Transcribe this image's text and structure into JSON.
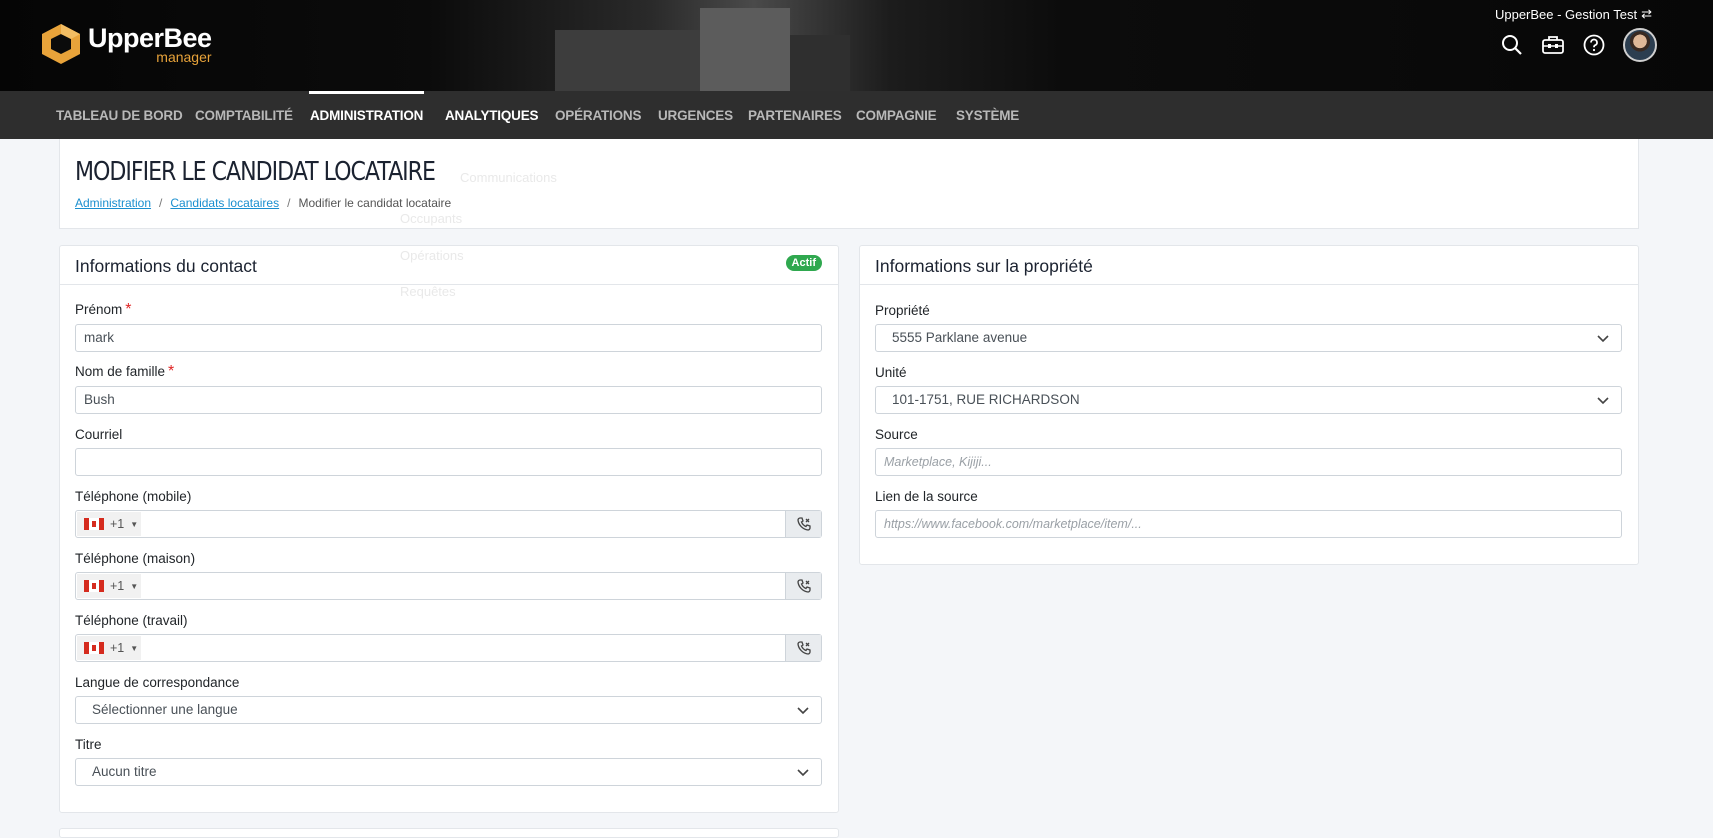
{
  "app": {
    "brand_main": "UpperBee",
    "brand_sub": "manager",
    "org_switch": "UpperBee - Gestion Test",
    "switch_glyph": "⇄"
  },
  "nav": [
    {
      "label": "TABLEAU DE BORD"
    },
    {
      "label": "COMPTABILITÉ"
    },
    {
      "label": "ADMINISTRATION"
    },
    {
      "label": "ANALYTIQUES"
    },
    {
      "label": "OPÉRATIONS"
    },
    {
      "label": "URGENCES"
    },
    {
      "label": "PARTENAIRES"
    },
    {
      "label": "COMPAGNIE"
    },
    {
      "label": "SYSTÈME"
    }
  ],
  "page": {
    "title": "MODIFIER LE CANDIDAT LOCATAIRE",
    "breadcrumb": [
      "Administration",
      "Candidats locataires",
      "Modifier le candidat locataire"
    ]
  },
  "ghost_menu": [
    "Communications",
    "Occupants",
    "Opérations",
    "Requêtes"
  ],
  "contact": {
    "title": "Informations du contact",
    "status": "Actif",
    "first_name_label": "Prénom",
    "first_name_value": "mark",
    "last_name_label": "Nom de famille",
    "last_name_value": "Bush",
    "email_label": "Courriel",
    "email_value": "",
    "phone_mobile_label": "Téléphone (mobile)",
    "phone_home_label": "Téléphone (maison)",
    "phone_work_label": "Téléphone (travail)",
    "dial_code": "+1",
    "language_label": "Langue de correspondance",
    "language_value": "Sélectionner une langue",
    "title_label": "Titre",
    "title_value": "Aucun titre",
    "required_mark": "*"
  },
  "property": {
    "title": "Informations sur la propriété",
    "property_label": "Propriété",
    "property_value": "5555 Parklane avenue",
    "unit_label": "Unité",
    "unit_value": "101-1751, RUE RICHARDSON",
    "source_label": "Source",
    "source_placeholder": "Marketplace, Kijiji...",
    "source_link_label": "Lien de la source",
    "source_link_placeholder": "https://www.facebook.com/marketplace/item/..."
  },
  "icons": {
    "logo": "hexagon-logo-icon",
    "search": "search-icon",
    "toolbox": "toolbox-icon",
    "help": "help-icon",
    "phone": "phone-x-icon",
    "chevron": "chevron-down-icon"
  },
  "colors": {
    "accent_orange": "#e8a33a",
    "active_badge": "#2fa84f",
    "link": "#1a8fcf",
    "required": "#e02424"
  }
}
